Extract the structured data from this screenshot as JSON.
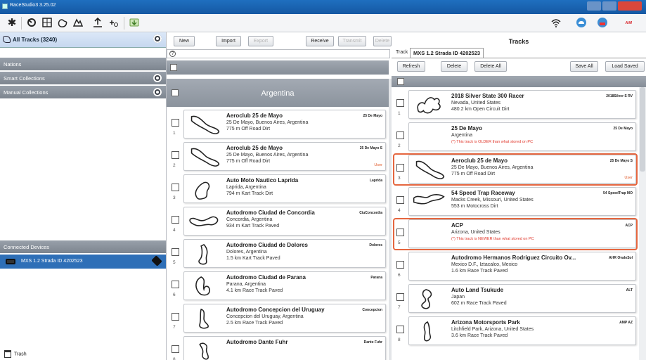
{
  "window": {
    "title": "RaceStudio3 3.25.02"
  },
  "sidebar": {
    "all_tracks_label": "All Tracks (3240)",
    "nations_label": "Nations",
    "smart_collections_label": "Smart Collections",
    "manual_collections_label": "Manual Collections",
    "connected_devices_label": "Connected Devices",
    "device_label": "MXS 1.2 Strada ID 4202523",
    "trash_label": "Trash"
  },
  "middle": {
    "buttons": {
      "new": "New",
      "import": "Import",
      "export": "Export",
      "receive": "Receive",
      "transmit": "Transmit",
      "delete": "Delete"
    },
    "country_header": "Argentina",
    "tracks": [
      {
        "num": "1",
        "name": "Aeroclub 25 de Mayo",
        "location": "25 De Mayo, Buenos Aires, Argentina",
        "details": "775 m Off Road Dirt",
        "short": "25 De Mayo",
        "user": ""
      },
      {
        "num": "2",
        "name": "Aeroclub 25 de Mayo",
        "location": "25 De Mayo, Buenos Aires, Argentina",
        "details": "775 m Off Road Dirt",
        "short": "25 De Mayo S",
        "user": "User"
      },
      {
        "num": "3",
        "name": "Auto Moto Nautico Laprida",
        "location": "Laprida, Argentina",
        "details": "794 m Kart Track Dirt",
        "short": "Laprida",
        "user": ""
      },
      {
        "num": "4",
        "name": "Autodromo Ciudad de Concordia",
        "location": "Concordia, Argentina",
        "details": "934 m Kart Track Paved",
        "short": "CiuConcordia",
        "user": ""
      },
      {
        "num": "5",
        "name": "Autodromo Ciudad de Dolores",
        "location": "Dolores, Argentina",
        "details": "1.5 km Kart Track Paved",
        "short": "Dolores",
        "user": ""
      },
      {
        "num": "6",
        "name": "Autodromo Ciudad de Parana",
        "location": "Parana, Argentina",
        "details": "4.1 km Race Track Paved",
        "short": "Parana",
        "user": ""
      },
      {
        "num": "7",
        "name": "Autodromo Concepcion del Uruguay",
        "location": "Concepcion del Uruguay, Argentina",
        "details": "2.5 km Race Track Paved",
        "short": "Concepcion",
        "user": ""
      },
      {
        "num": "8",
        "name": "Autodromo Dante Fuhr",
        "location": "",
        "details": "",
        "short": "Dante Fuhr",
        "user": ""
      }
    ]
  },
  "right": {
    "header": "Tracks",
    "track_label": "Track",
    "device_tab": "MXS 1.2 Strada ID 4202523",
    "buttons": {
      "refresh": "Refresh",
      "delete": "Delete",
      "delete_all": "Delete All",
      "save_all": "Save All",
      "load_saved": "Load Saved"
    },
    "tracks": [
      {
        "num": "1",
        "name": "2018 Silver State 300 Racer",
        "location": "Nevada, United States",
        "details": "480.2 km Open Circuit Dirt",
        "short": "2018Silver S RV",
        "user": "",
        "warn": ""
      },
      {
        "num": "2",
        "name": "25 De Mayo",
        "location": "Argentina",
        "details": "",
        "short": "25 De Mayo",
        "user": "",
        "warn": "(*) This track is OLDER than what stored on PC"
      },
      {
        "num": "3",
        "name": "Aeroclub 25 de Mayo",
        "location": "25 De Mayo, Buenos Aires, Argentina",
        "details": "775 m Off Road Dirt",
        "short": "25 De Mayo S",
        "user": "User",
        "warn": ""
      },
      {
        "num": "4",
        "name": "54 Speed Trap Raceway",
        "location": "Macks Creek, Missouri, United States",
        "details": "553 m Motocross Dirt",
        "short": "54 SpeedTrap MO",
        "user": "",
        "warn": ""
      },
      {
        "num": "5",
        "name": "ACP",
        "location": "Arizona, United States",
        "details": "",
        "short": "ACP",
        "user": "",
        "warn": "(*) This track is NEWER than what stored on PC"
      },
      {
        "num": "6",
        "name": "Autodromo Hermanos Rodriguez Circuito Ov...",
        "location": "Mexico D.F., Iztacalco, Mexico",
        "details": "1.6 km Race Track Paved",
        "short": "AHR OvaloSol",
        "user": "",
        "warn": ""
      },
      {
        "num": "7",
        "name": "Auto Land Tsukude",
        "location": "Japan",
        "details": "602 m Race Track Paved",
        "short": "ALT",
        "user": "",
        "warn": ""
      },
      {
        "num": "8",
        "name": "Arizona Motorsports Park",
        "location": "Litchfield Park, Arizona, United States",
        "details": "3.6 km Race Track Paved",
        "short": "AMP AZ",
        "user": "",
        "warn": ""
      }
    ]
  },
  "colors": {
    "accent": "#2e6fb7",
    "highlight": "#e5663f",
    "warning": "#e0362a",
    "user": "#e05a2a"
  }
}
